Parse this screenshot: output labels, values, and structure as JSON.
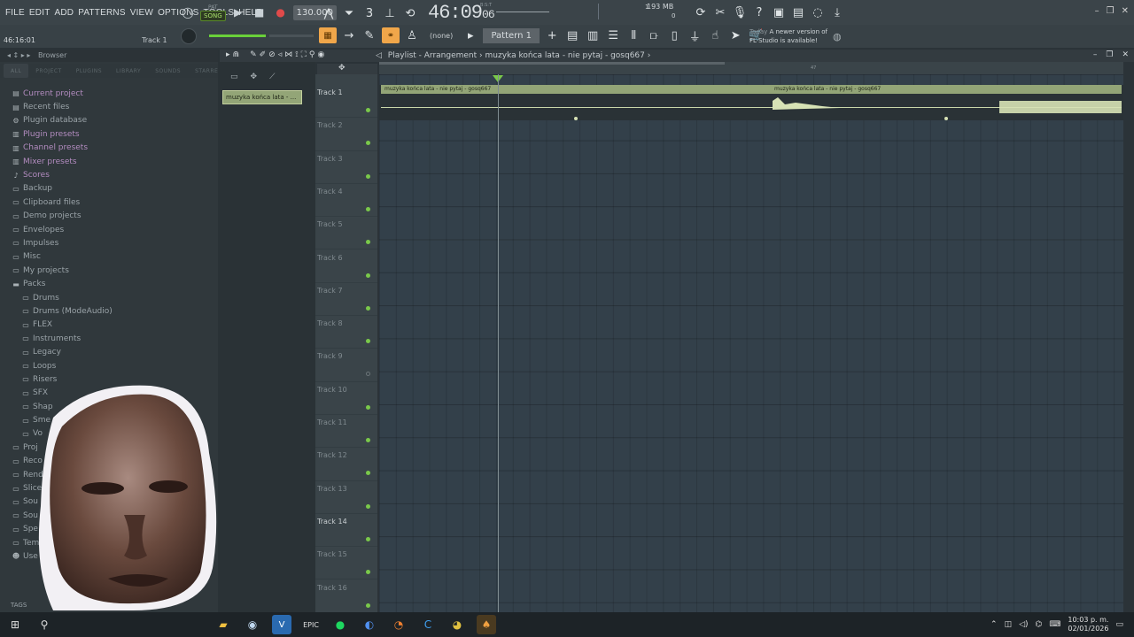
{
  "menu": [
    "FILE",
    "EDIT",
    "ADD",
    "PATTERNS",
    "VIEW",
    "OPTIONS",
    "TOOLS",
    "HELP"
  ],
  "transport": {
    "mode_top": "PAT",
    "mode_label": "SONG",
    "tempo": "130.000",
    "time": "46:09",
    "time_small": "06",
    "time_sub": "B:S:T"
  },
  "monitor": {
    "ram": "193 MB",
    "cpu_value": "1",
    "voices": "0"
  },
  "hint_time": "46:16:01",
  "selected_track_label": "Track 1",
  "pattern": {
    "none_label": "(none)",
    "name": "Pattern 1"
  },
  "news": {
    "when": "Today",
    "line1": "A newer version of",
    "line2": "FL Studio is available!"
  },
  "browser": {
    "title": "Browser",
    "tabs": [
      "ALL",
      "PROJECT",
      "PLUGINS",
      "LIBRARY",
      "SOUNDS",
      "STARRED"
    ],
    "items": [
      {
        "label": "Current project",
        "icon": "project-icon",
        "purple": true
      },
      {
        "label": "Recent files",
        "icon": "recent-icon",
        "purple": false
      },
      {
        "label": "Plugin database",
        "icon": "plugin-db-icon",
        "purple": false
      },
      {
        "label": "Plugin presets",
        "icon": "plugin-presets-icon",
        "purple": true
      },
      {
        "label": "Channel presets",
        "icon": "channel-presets-icon",
        "purple": true
      },
      {
        "label": "Mixer presets",
        "icon": "mixer-presets-icon",
        "purple": true
      },
      {
        "label": "Scores",
        "icon": "note-icon",
        "purple": true
      },
      {
        "label": "Backup",
        "icon": "folder-icon",
        "purple": false
      },
      {
        "label": "Clipboard files",
        "icon": "folder-icon",
        "purple": false
      },
      {
        "label": "Demo projects",
        "icon": "folder-icon",
        "purple": false
      },
      {
        "label": "Envelopes",
        "icon": "folder-icon",
        "purple": false
      },
      {
        "label": "Impulses",
        "icon": "folder-icon",
        "purple": false
      },
      {
        "label": "Misc",
        "icon": "folder-icon",
        "purple": false
      },
      {
        "label": "My projects",
        "icon": "folder-icon",
        "purple": false
      },
      {
        "label": "Packs",
        "icon": "folder-open-icon",
        "purple": false
      },
      {
        "label": "Drums",
        "icon": "folder-icon",
        "purple": false,
        "indent": true
      },
      {
        "label": "Drums (ModeAudio)",
        "icon": "folder-icon",
        "purple": false,
        "indent": true
      },
      {
        "label": "FLEX",
        "icon": "folder-icon",
        "purple": false,
        "indent": true
      },
      {
        "label": "Instruments",
        "icon": "folder-icon",
        "purple": false,
        "indent": true
      },
      {
        "label": "Legacy",
        "icon": "folder-icon",
        "purple": false,
        "indent": true
      },
      {
        "label": "Loops",
        "icon": "folder-icon",
        "purple": false,
        "indent": true
      },
      {
        "label": "Risers",
        "icon": "folder-icon",
        "purple": false,
        "indent": true
      },
      {
        "label": "SFX",
        "icon": "folder-icon",
        "purple": false,
        "indent": true
      },
      {
        "label": "Shap",
        "icon": "folder-icon",
        "purple": false,
        "indent": true
      },
      {
        "label": "Sme",
        "icon": "folder-icon",
        "purple": false,
        "indent": true
      },
      {
        "label": "Vo",
        "icon": "folder-icon",
        "purple": false,
        "indent": true
      },
      {
        "label": "Proj",
        "icon": "folder-icon",
        "purple": false
      },
      {
        "label": "Reco",
        "icon": "folder-icon",
        "purple": false
      },
      {
        "label": "Rend",
        "icon": "folder-icon",
        "purple": false
      },
      {
        "label": "Slice",
        "icon": "folder-icon",
        "purple": false
      },
      {
        "label": "Sou",
        "icon": "folder-icon",
        "purple": false
      },
      {
        "label": "Sou",
        "icon": "folder-icon",
        "purple": false
      },
      {
        "label": "Spe",
        "icon": "folder-icon",
        "purple": false
      },
      {
        "label": "Tem",
        "icon": "folder-icon",
        "purple": false
      },
      {
        "label": "Use",
        "icon": "user-icon",
        "purple": false
      }
    ],
    "tags_label": "TAGS"
  },
  "clip_source": "muzyka końca lata - ...",
  "playlist": {
    "title": "Playlist - Arrangement",
    "breadcrumb": "muzyka końca lata - nie pytaj - gosq667",
    "ruler_mark": "47",
    "clip_name": "muzyka końca lata - nie pytaj - gosq667",
    "tracks": [
      "Track 1",
      "Track 2",
      "Track 3",
      "Track 4",
      "Track 5",
      "Track 6",
      "Track 7",
      "Track 8",
      "Track 9",
      "Track 10",
      "Track 11",
      "Track 12",
      "Track 13",
      "Track 14",
      "Track 15",
      "Track 16"
    ]
  },
  "taskbar": {
    "time": "10:03 p. m.",
    "date": "02/01/2026"
  },
  "colors": {
    "accent_orange": "#f0a64a",
    "clip_green": "#93a577",
    "track_led": "#7ac94a"
  }
}
